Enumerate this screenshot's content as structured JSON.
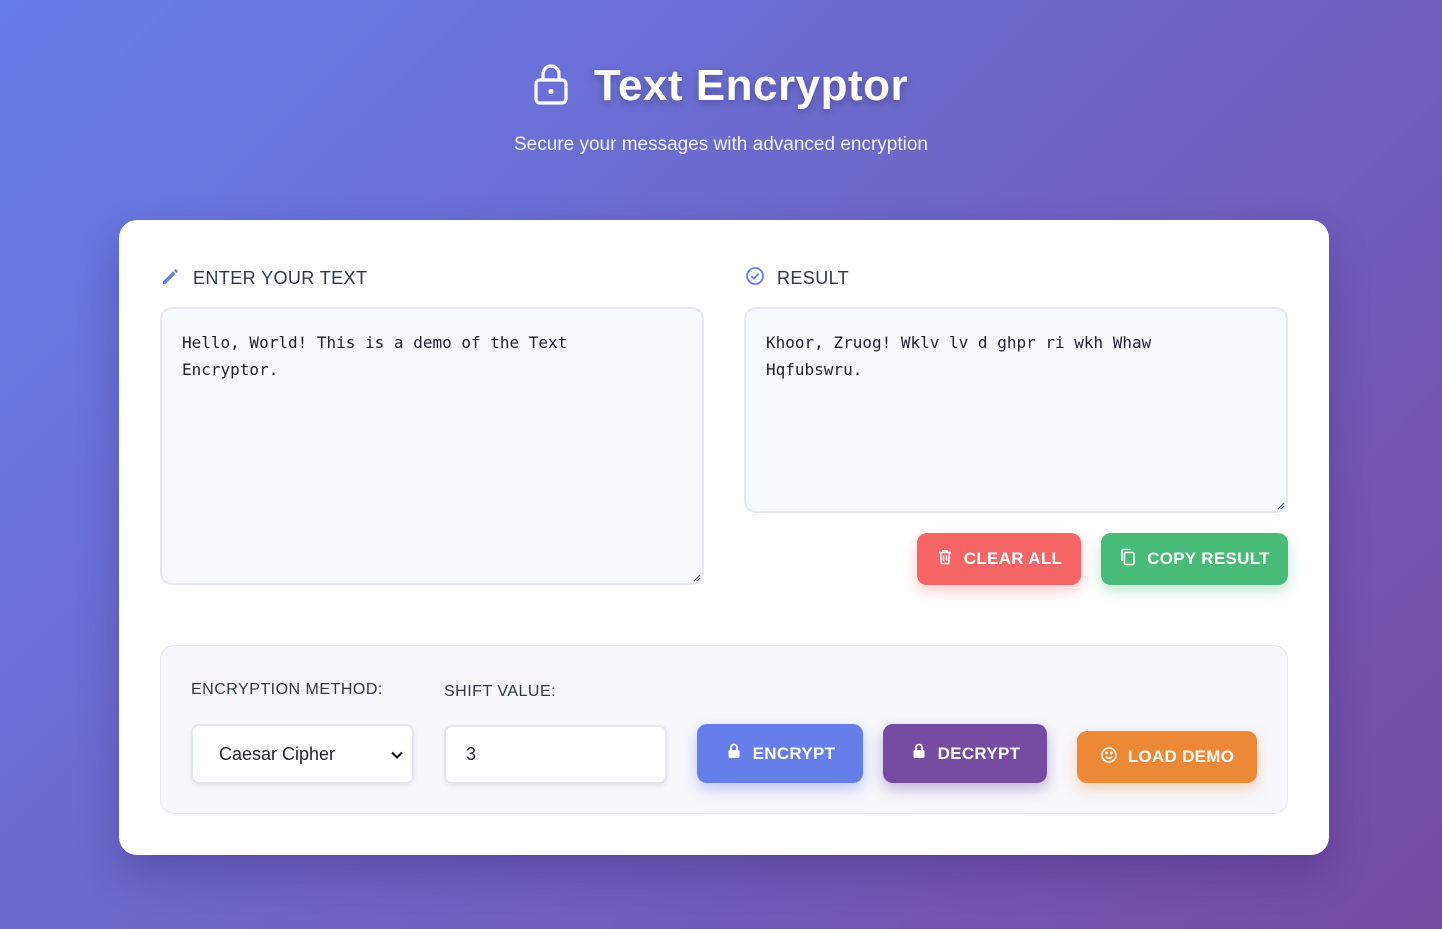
{
  "header": {
    "title": "Text Encryptor",
    "subtitle": "Secure your messages with advanced encryption",
    "icon": "lock-icon"
  },
  "input_panel": {
    "label": "ENTER YOUR TEXT",
    "icon": "pencil-icon",
    "value": "Hello, World! This is a demo of the Text\nEncryptor."
  },
  "result_panel": {
    "label": "RESULT",
    "icon": "check-circle-icon",
    "value": "Khoor, Zruog! Wklv lv d ghpr ri wkh Whaw\nHqfubswru."
  },
  "actions": {
    "clear_label": "CLEAR ALL",
    "copy_label": "COPY RESULT"
  },
  "controls": {
    "method_label": "ENCRYPTION METHOD:",
    "method_value": "Caesar Cipher",
    "shift_label": "SHIFT VALUE:",
    "shift_value": "3",
    "encrypt_label": "ENCRYPT",
    "decrypt_label": "DECRYPT",
    "demo_label": "LOAD DEMO"
  },
  "colors": {
    "gradient_start": "#667eea",
    "gradient_end": "#764ba2",
    "clear": "#f56565",
    "copy": "#48bb78",
    "encrypt": "#667eea",
    "decrypt": "#764ba2",
    "demo": "#ed8936"
  }
}
